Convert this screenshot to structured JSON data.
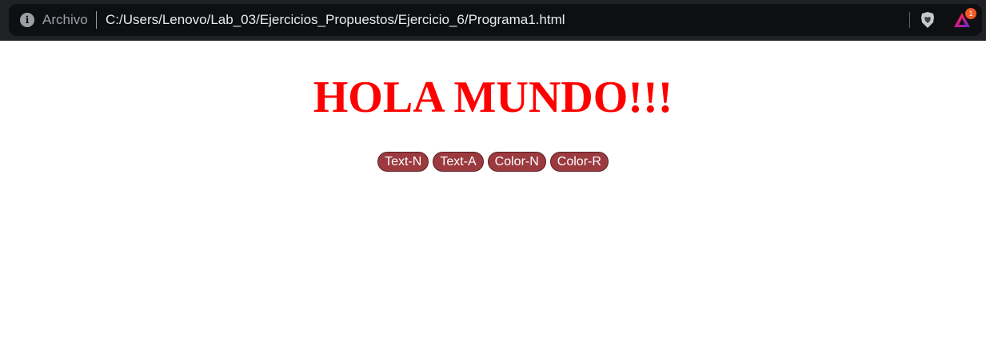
{
  "browser": {
    "scheme_label": "Archivo",
    "url": "C:/Users/Lenovo/Lab_03/Ejercicios_Propuestos/Ejercicio_6/Programa1.html",
    "info_icon": "info-icon",
    "rewards_badge_count": "1"
  },
  "page": {
    "title": "HOLA MUNDO!!!",
    "title_color": "#ff0000",
    "buttons": [
      {
        "label": "Text-N"
      },
      {
        "label": "Text-A"
      },
      {
        "label": "Color-N"
      },
      {
        "label": "Color-R"
      }
    ],
    "button_color": "#9b3a3f"
  }
}
